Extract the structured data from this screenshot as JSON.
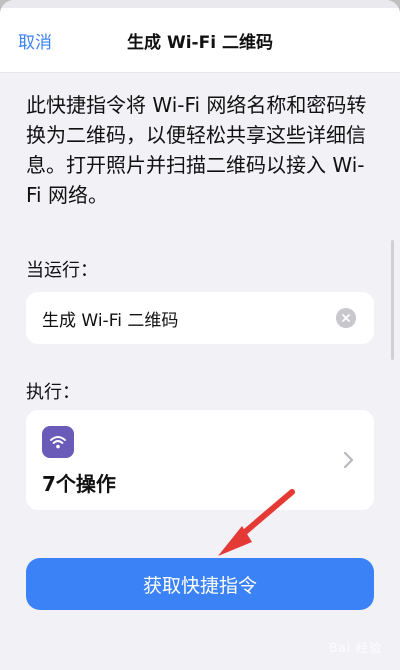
{
  "nav": {
    "cancel": "取消",
    "title": "生成 Wi-Fi 二维码"
  },
  "description": "此快捷指令将 Wi-Fi 网络名称和密码转换为二维码，以便轻松共享这些详细信息。打开照片并扫描二维码以接入 Wi-Fi 网络。",
  "when_run": {
    "label": "当运行：",
    "value": "生成 Wi-Fi 二维码",
    "clear_icon": "clear-icon"
  },
  "do": {
    "label": "执行：",
    "action_icon": "wifi-icon",
    "actions_count": "7个操作",
    "chevron_icon": "chevron-right-icon"
  },
  "primary_button": {
    "label": "获取快捷指令"
  },
  "watermark": {
    "text": "Bai 经验"
  },
  "colors": {
    "accent": "#3b82f6",
    "wifi_badge": "#6b5bb8",
    "annotation_arrow": "#e53935"
  }
}
